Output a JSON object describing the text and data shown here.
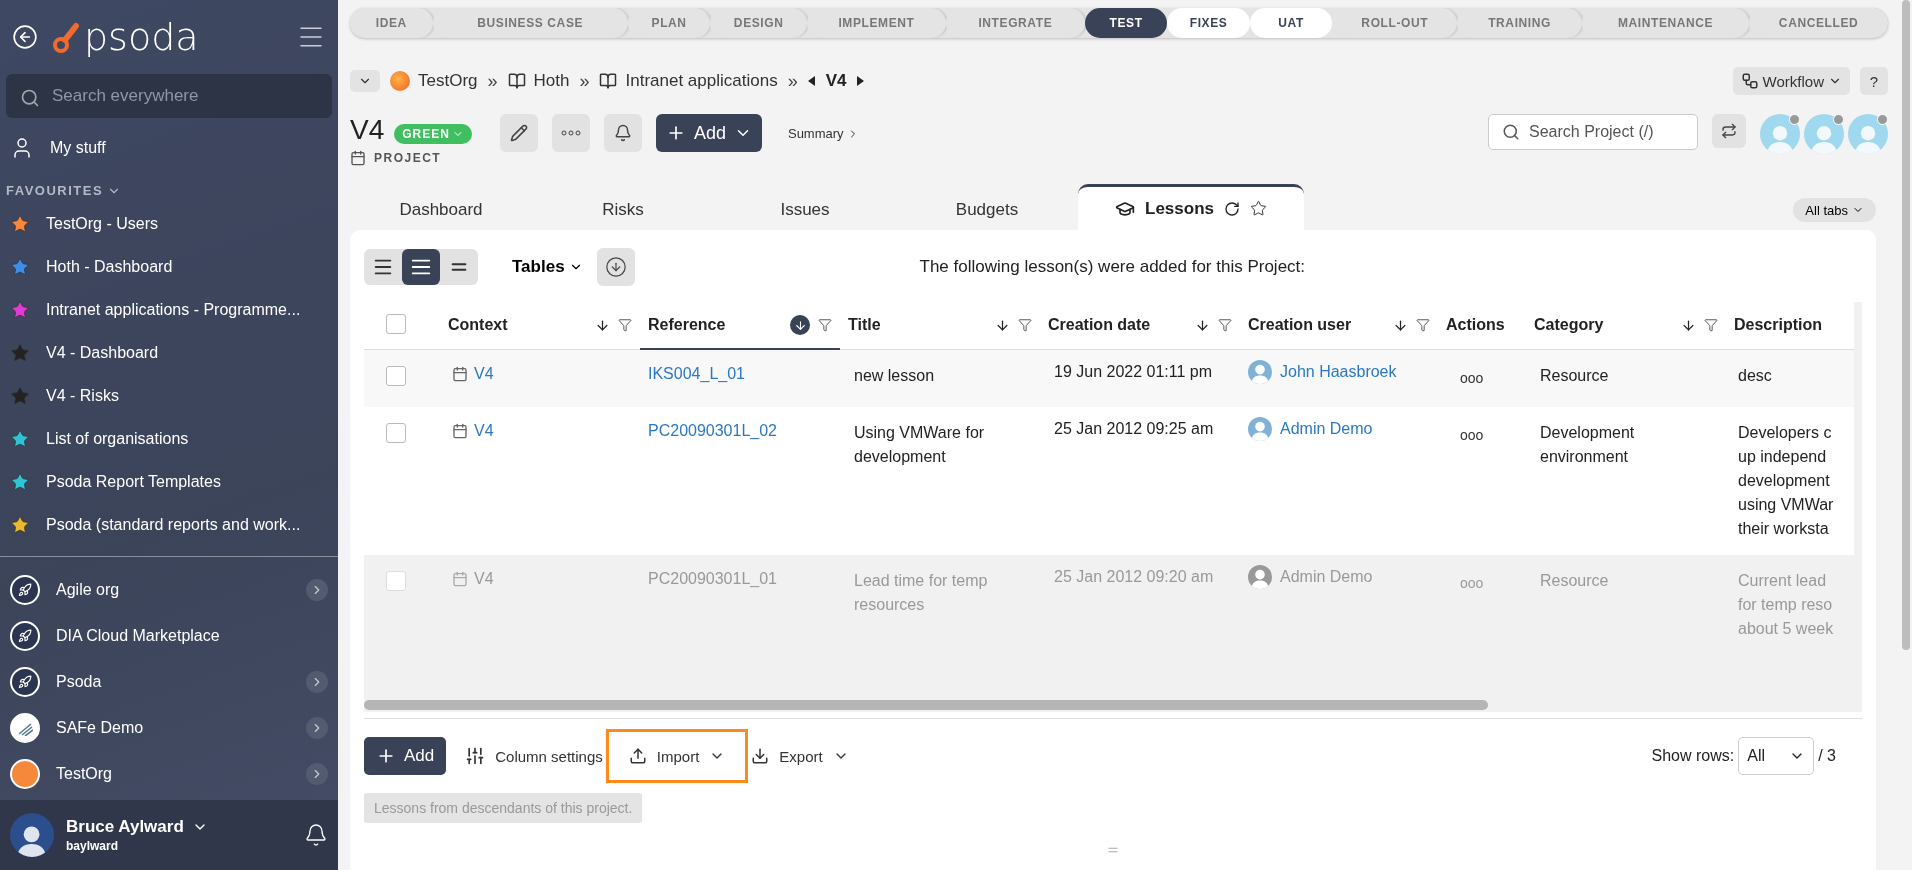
{
  "sidebar": {
    "logo": "psoda",
    "search": {
      "placeholder": "Search everywhere"
    },
    "my_stuff": "My stuff",
    "favourites_heading": "FAVOURITES",
    "favourites": [
      {
        "label": "TestOrg - Users",
        "color": "#f5883a"
      },
      {
        "label": "Hoth - Dashboard",
        "color": "#3d8ee8"
      },
      {
        "label": "Intranet applications - Programme...",
        "color": "#e23ad6"
      },
      {
        "label": "V4 - Dashboard",
        "color": "#222222"
      },
      {
        "label": "V4 - Risks",
        "color": "#222222"
      },
      {
        "label": "List of organisations",
        "color": "#2ec4d6"
      },
      {
        "label": "Psoda Report Templates",
        "color": "#2ec4d6"
      },
      {
        "label": "Psoda (standard reports and work...",
        "color": "#e8b92a"
      }
    ],
    "organisations": [
      {
        "label": "Agile org",
        "kind": "rocket",
        "has_children": true
      },
      {
        "label": "DIA Cloud Marketplace",
        "kind": "rocket",
        "has_children": false
      },
      {
        "label": "Psoda",
        "kind": "rocket",
        "has_children": true
      },
      {
        "label": "SAFe Demo",
        "kind": "stripes",
        "has_children": true
      },
      {
        "label": "TestOrg",
        "kind": "sun",
        "has_children": true
      }
    ],
    "user": {
      "name": "Bruce Aylward",
      "username": "baylward"
    }
  },
  "stages": [
    {
      "label": "IDEA",
      "selected": false,
      "upcoming": false
    },
    {
      "label": "BUSINESS CASE",
      "selected": false,
      "upcoming": false
    },
    {
      "label": "PLAN",
      "selected": false,
      "upcoming": false
    },
    {
      "label": "DESIGN",
      "selected": false,
      "upcoming": false
    },
    {
      "label": "IMPLEMENT",
      "selected": false,
      "upcoming": false
    },
    {
      "label": "INTEGRATE",
      "selected": false,
      "upcoming": false
    },
    {
      "label": "TEST",
      "selected": true,
      "upcoming": false
    },
    {
      "label": "FIXES",
      "selected": false,
      "upcoming": true
    },
    {
      "label": "UAT",
      "selected": false,
      "upcoming": true
    },
    {
      "label": "ROLL-OUT",
      "selected": false,
      "upcoming": false
    },
    {
      "label": "TRAINING",
      "selected": false,
      "upcoming": false
    },
    {
      "label": "MAINTENANCE",
      "selected": false,
      "upcoming": false
    },
    {
      "label": "CANCELLED",
      "selected": false,
      "upcoming": false
    }
  ],
  "breadcrumb": {
    "items": [
      {
        "label": "TestOrg",
        "kind": "org",
        "separator": "»"
      },
      {
        "label": "Hoth",
        "kind": "book",
        "separator": "»"
      },
      {
        "label": "Intranet applications",
        "kind": "book",
        "separator": "»"
      }
    ],
    "current": "V4"
  },
  "workflow": "Workflow",
  "help": "?",
  "project": {
    "title": "V4",
    "status": "GREEN",
    "type": "PROJECT",
    "add": "Add",
    "summary": "Summary"
  },
  "project_search": {
    "placeholder": "Search Project (/)"
  },
  "tabs": [
    {
      "label": "Dashboard",
      "selected": false
    },
    {
      "label": "Risks",
      "selected": false
    },
    {
      "label": "Issues",
      "selected": false
    },
    {
      "label": "Budgets",
      "selected": false
    },
    {
      "label": "Lessons",
      "selected": true
    }
  ],
  "all_tabs": "All tabs",
  "views": [
    {
      "kind": "compact",
      "selected": false
    },
    {
      "kind": "normal",
      "selected": true
    },
    {
      "kind": "dense",
      "selected": false
    }
  ],
  "tables_menu": "Tables",
  "caption": "The following lesson(s) were added for this Project:",
  "table": {
    "select_all_checked": false,
    "columns": [
      {
        "label": "Context",
        "sortable": true,
        "sorted": false
      },
      {
        "label": "Reference",
        "sortable": true,
        "sorted": true
      },
      {
        "label": "Title",
        "sortable": true,
        "sorted": false
      },
      {
        "label": "Creation date",
        "sortable": true,
        "sorted": false
      },
      {
        "label": "Creation user",
        "sortable": true,
        "sorted": false
      },
      {
        "label": "Actions",
        "sortable": false
      },
      {
        "label": "Category",
        "sortable": true,
        "sorted": false
      },
      {
        "label": "Description",
        "sortable": false
      }
    ],
    "rows": [
      {
        "checked": false,
        "disabled": false,
        "context": "V4",
        "reference": "IKS004_L_01",
        "title": "new lesson",
        "date": "19 Jun 2022 01:11 pm",
        "user": "John Haasbroek",
        "actions": "ooo",
        "category": "Resource",
        "description": [
          "desc"
        ]
      },
      {
        "checked": false,
        "disabled": false,
        "context": "V4",
        "reference": "PC20090301L_02",
        "title": "Using VMWare for development",
        "date": "25 Jan 2012 09:25 am",
        "user": "Admin Demo",
        "actions": "ooo",
        "category": "Development environment",
        "description": [
          "Developers c",
          "up independ",
          "development",
          "using VMWar",
          "their worksta"
        ]
      },
      {
        "checked": false,
        "disabled": true,
        "context": "V4",
        "reference": "PC20090301L_01",
        "title": "Lead time for temp resources",
        "date": "25 Jan 2012 09:20 am",
        "user": "Admin Demo",
        "actions": "ooo",
        "category": "Resource",
        "description": [
          "Current lead",
          "for temp reso",
          "about 5 week"
        ]
      }
    ]
  },
  "footer": {
    "add": "Add",
    "column_settings": "Column settings",
    "import": {
      "label": "Import",
      "highlighted": true
    },
    "export": "Export",
    "show_rows_label": "Show rows:",
    "show_rows_value": "All",
    "total": "/ 3",
    "descendants": "Lessons from descendants of this project."
  }
}
